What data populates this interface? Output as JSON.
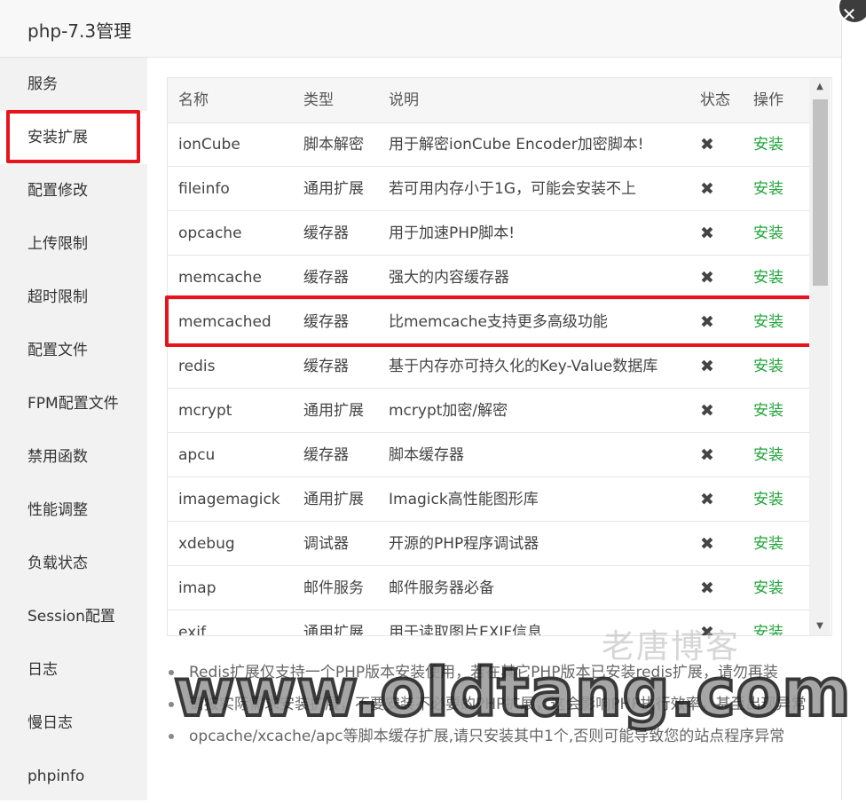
{
  "window": {
    "title": "php-7.3管理",
    "close_glyph": "✕"
  },
  "sidebar": {
    "items": [
      {
        "label": "服务"
      },
      {
        "label": "安装扩展",
        "active": true
      },
      {
        "label": "配置修改"
      },
      {
        "label": "上传限制"
      },
      {
        "label": "超时限制"
      },
      {
        "label": "配置文件"
      },
      {
        "label": "FPM配置文件"
      },
      {
        "label": "禁用函数"
      },
      {
        "label": "性能调整"
      },
      {
        "label": "负载状态"
      },
      {
        "label": "Session配置"
      },
      {
        "label": "日志"
      },
      {
        "label": "慢日志"
      },
      {
        "label": "phpinfo"
      }
    ]
  },
  "table": {
    "headers": {
      "name": "名称",
      "type": "类型",
      "desc": "说明",
      "status": "状态",
      "op": "操作"
    },
    "rows": [
      {
        "name": "ionCube",
        "type": "脚本解密",
        "desc": "用于解密ionCube Encoder加密脚本!",
        "status": "✖",
        "op": "安装"
      },
      {
        "name": "fileinfo",
        "type": "通用扩展",
        "desc": "若可用内存小于1G，可能会安装不上",
        "status": "✖",
        "op": "安装"
      },
      {
        "name": "opcache",
        "type": "缓存器",
        "desc": "用于加速PHP脚本!",
        "status": "✖",
        "op": "安装"
      },
      {
        "name": "memcache",
        "type": "缓存器",
        "desc": "强大的内容缓存器",
        "status": "✖",
        "op": "安装"
      },
      {
        "name": "memcached",
        "type": "缓存器",
        "desc": "比memcache支持更多高级功能",
        "status": "✖",
        "op": "安装"
      },
      {
        "name": "redis",
        "type": "缓存器",
        "desc": "基于内存亦可持久化的Key-Value数据库",
        "status": "✖",
        "op": "安装"
      },
      {
        "name": "mcrypt",
        "type": "通用扩展",
        "desc": "mcrypt加密/解密",
        "status": "✖",
        "op": "安装"
      },
      {
        "name": "apcu",
        "type": "缓存器",
        "desc": "脚本缓存器",
        "status": "✖",
        "op": "安装"
      },
      {
        "name": "imagemagick",
        "type": "通用扩展",
        "desc": "Imagick高性能图形库",
        "status": "✖",
        "op": "安装"
      },
      {
        "name": "xdebug",
        "type": "调试器",
        "desc": "开源的PHP程序调试器",
        "status": "✖",
        "op": "安装"
      },
      {
        "name": "imap",
        "type": "邮件服务",
        "desc": "邮件服务器必备",
        "status": "✖",
        "op": "安装"
      },
      {
        "name": "exif",
        "type": "通用扩展",
        "desc": "用于读取图片EXIF信息",
        "status": "✖",
        "op": "安装"
      }
    ]
  },
  "notes": [
    "Redis扩展仅支持一个PHP版本安装使用，若在其它PHP版本已安装redis扩展，请勿再装",
    "请按实际需求安装扩展，不要安装不必要的PHP扩展，这会影响PHP执行效率，甚至出现异常",
    "opcache/xcache/apc等脚本缓存扩展,请只安装其中1个,否则可能导致您的站点程序异常"
  ],
  "watermark": {
    "cn": "老唐博客",
    "url": "www.oldtang.com"
  },
  "colors": {
    "accent_green": "#20a53a",
    "highlight_red": "#e8141c"
  }
}
